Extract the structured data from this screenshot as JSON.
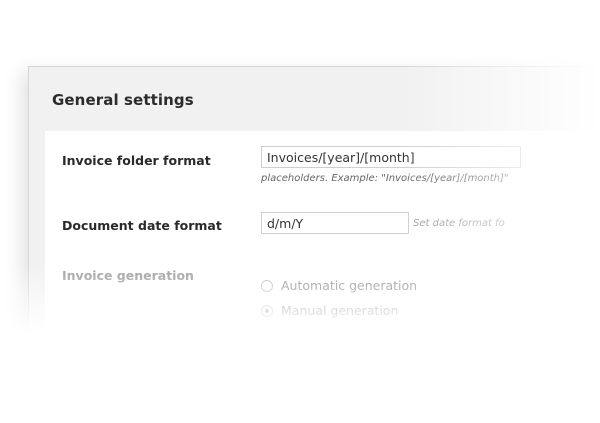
{
  "panel": {
    "title": "General settings"
  },
  "fields": {
    "invoice_folder_format": {
      "label": "Invoice folder format",
      "value": "Invoices/[year]/[month]",
      "hint": "placeholders. Example: \"Invoices/[year]/[month]\""
    },
    "document_date_format": {
      "label": "Document date format",
      "value": "d/m/Y",
      "hint": "Set date format fo"
    },
    "invoice_generation": {
      "label": "Invoice generation",
      "options": [
        {
          "label": "Automatic generation",
          "selected": false
        },
        {
          "label": "Manual generation",
          "selected": true
        }
      ]
    }
  }
}
